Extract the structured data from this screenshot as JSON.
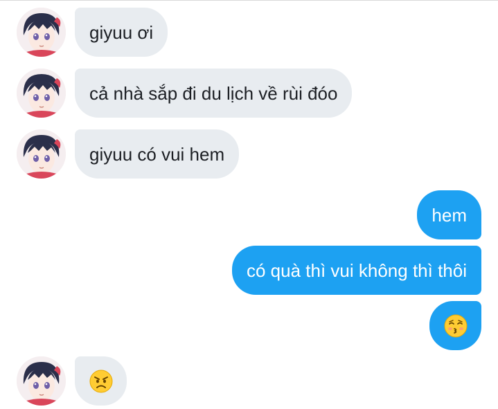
{
  "conversation": {
    "messages": [
      {
        "sender": "other",
        "text": "giyuu ơi"
      },
      {
        "sender": "other",
        "text": "cả nhà sắp đi du lịch về rùi đóo"
      },
      {
        "sender": "other",
        "text": "giyuu có vui hem"
      },
      {
        "sender": "me",
        "text": "hem"
      },
      {
        "sender": "me",
        "text": "có quà thì vui không thì thôi"
      },
      {
        "sender": "me",
        "emoji": "kissing-face-closed-eyes"
      },
      {
        "sender": "other",
        "emoji": "angry-face"
      }
    ]
  },
  "colors": {
    "incoming_bubble": "#e8ecf0",
    "outgoing_bubble": "#1da1f2",
    "incoming_text": "#1c1f24",
    "outgoing_text": "#ffffff"
  }
}
